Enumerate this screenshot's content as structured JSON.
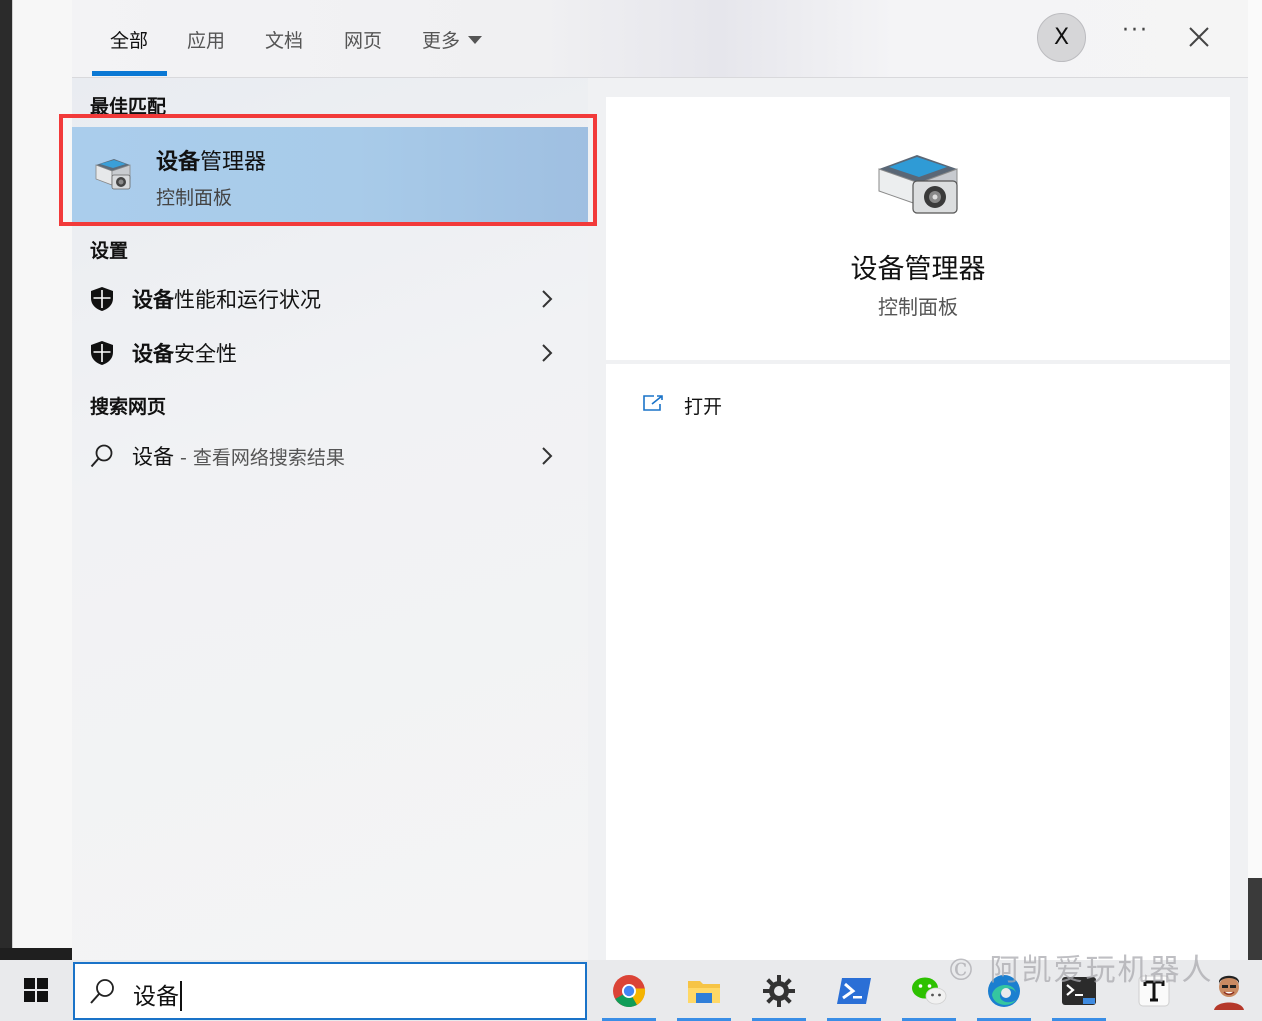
{
  "tabs": [
    {
      "label": "全部"
    },
    {
      "label": "应用"
    },
    {
      "label": "文档"
    },
    {
      "label": "网页"
    },
    {
      "label": "更多"
    }
  ],
  "header": {
    "user_initial": "X",
    "more_label": "···"
  },
  "sections": {
    "best_match": "最佳匹配",
    "settings": "设置",
    "web": "搜索网页"
  },
  "best_match": {
    "title_bold": "设备",
    "title_rest": "管理器",
    "subtitle": "控制面板"
  },
  "settings_items": [
    {
      "bold": "设备",
      "rest": "性能和运行状况"
    },
    {
      "bold": "设备",
      "rest": "安全性"
    }
  ],
  "web_item": {
    "query": "设备",
    "extra": " - 查看网络搜索结果"
  },
  "detail": {
    "title": "设备管理器",
    "subtitle": "控制面板",
    "open_label": "打开"
  },
  "search": {
    "value": "设备"
  },
  "watermark": "© 阿凯爱玩机器人",
  "taskbar_apps": [
    "chrome-icon",
    "file-explorer-icon",
    "settings-gear-icon",
    "powershell-icon",
    "wechat-icon",
    "edge-icon",
    "terminal-preview-icon",
    "typora-icon",
    "user-avatar"
  ],
  "colors": {
    "accent": "#0a78d4",
    "highlight": "#aacdec",
    "outline": "#f23a3a"
  }
}
